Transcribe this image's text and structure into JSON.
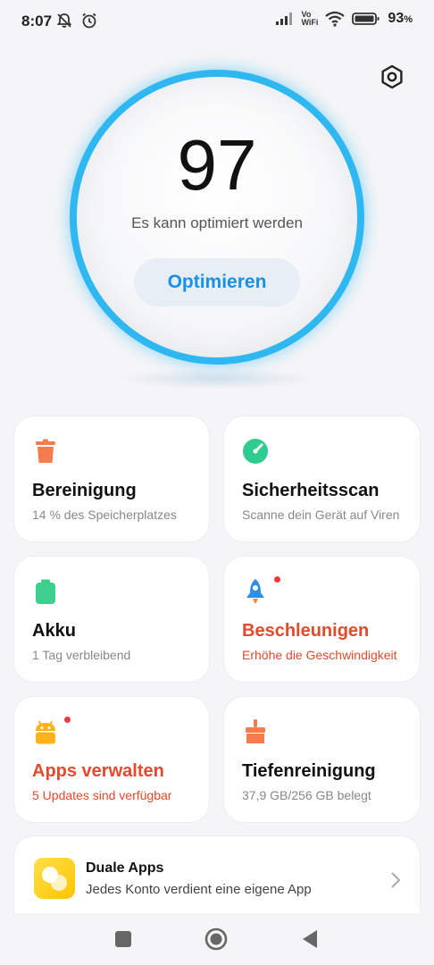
{
  "status_bar": {
    "time": "8:07",
    "network_label_top": "Vo",
    "network_label_bottom": "WiFi",
    "battery_percent": "93",
    "battery_unit": "%"
  },
  "score": {
    "value": "97",
    "subtitle": "Es kann optimiert werden",
    "button_label": "Optimieren"
  },
  "cards": [
    {
      "title": "Bereinigung",
      "subtitle": "14 % des Speicherplatzes",
      "icon": "trash-icon",
      "color": "#f57c4c"
    },
    {
      "title": "Sicherheitsscan",
      "subtitle": "Scanne dein Gerät auf Viren",
      "icon": "shield-scan-icon",
      "color": "#2ecc8f"
    },
    {
      "title": "Akku",
      "subtitle": "1 Tag  verbleibend",
      "icon": "battery-icon",
      "color": "#3ccf8e"
    },
    {
      "title": "Beschleunigen",
      "subtitle": "Erhöhe die Geschwindigkeit",
      "icon": "rocket-icon",
      "color": "#2f8fe8"
    },
    {
      "title": "Apps verwalten",
      "subtitle": "5 Updates sind verfügbar",
      "icon": "android-icon",
      "color": "#ffb21c"
    },
    {
      "title": "Tiefenreinigung",
      "subtitle": "37,9 GB/256 GB belegt",
      "icon": "brush-icon",
      "color": "#f57c4c"
    }
  ],
  "dual_apps": {
    "title": "Duale Apps",
    "subtitle": "Jedes Konto verdient eine eigene App"
  },
  "colors": {
    "accent": "#1a8fe3",
    "ring": "#2eb7f0",
    "alert": "#e24a2c"
  }
}
